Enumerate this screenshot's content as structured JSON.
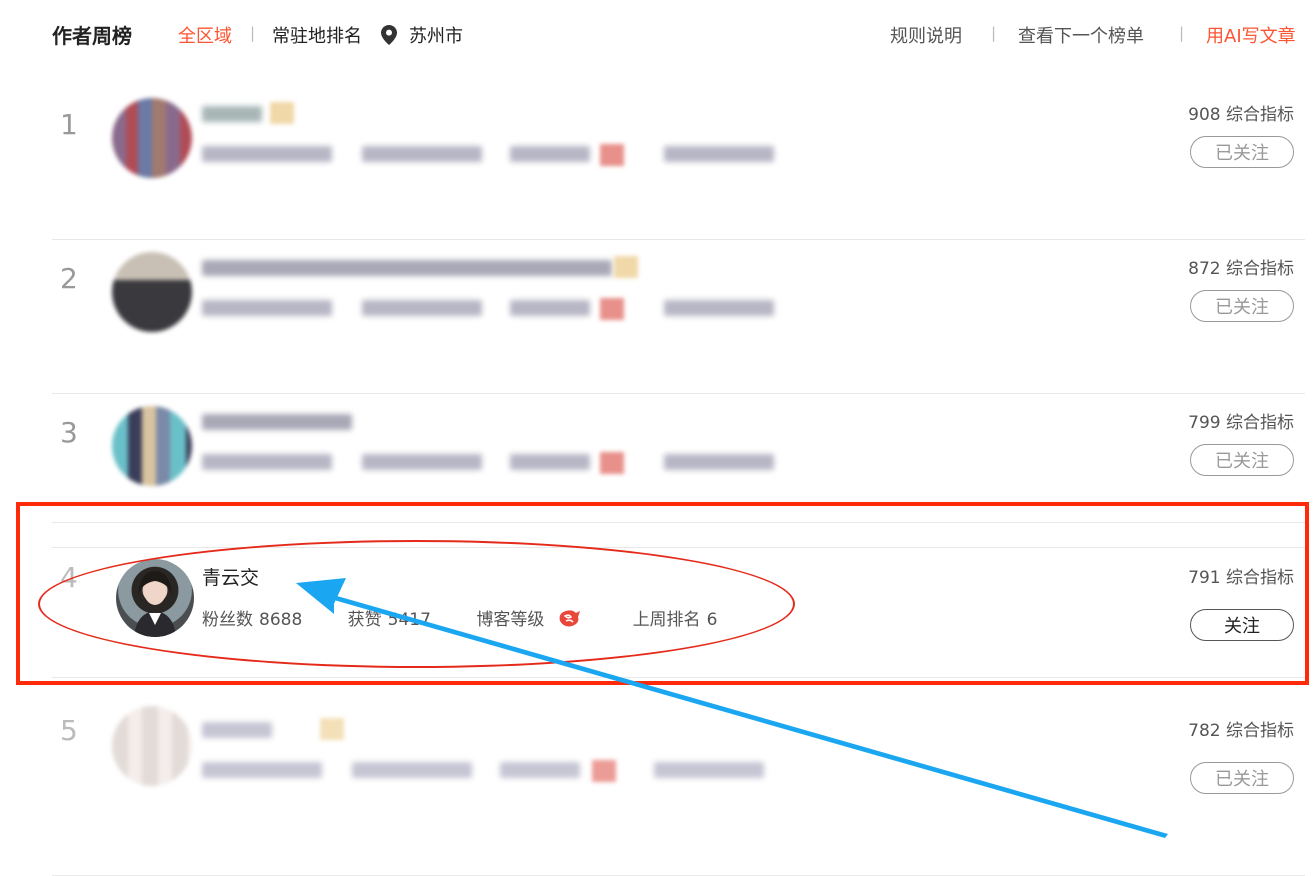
{
  "header": {
    "title": "作者周榜",
    "filter_all": "全区域",
    "filter_local": "常驻地排名",
    "city": "苏州市",
    "rules": "规则说明",
    "next_list": "查看下一个榜单",
    "ai_write": "用AI写文章",
    "separator": "|"
  },
  "rows": [
    {
      "rank": "1",
      "score": "908 综合指标",
      "follow": "已关注"
    },
    {
      "rank": "2",
      "score": "872 综合指标",
      "follow": "已关注"
    },
    {
      "rank": "3",
      "score": "799 综合指标",
      "follow": "已关注"
    },
    {
      "rank": "4",
      "name": "青云交",
      "fans_label": "粉丝数",
      "fans": "8688",
      "likes_label": "获赞",
      "likes": "5417",
      "level_label": "博客等级",
      "last_rank_label": "上周排名",
      "last_rank": "6",
      "score": "791 综合指标",
      "follow": "关注"
    },
    {
      "rank": "5",
      "score": "782 综合指标",
      "follow": "已关注"
    }
  ],
  "colors": {
    "accent": "#fc5531",
    "annotation_red": "#ff2a0a",
    "arrow_blue": "#1aa6f0"
  }
}
